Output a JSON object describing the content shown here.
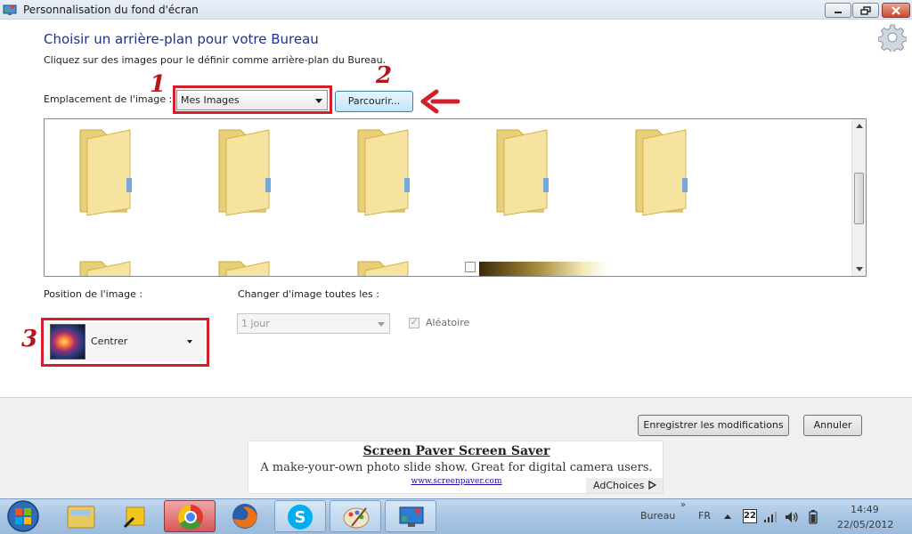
{
  "window": {
    "title": "Personnalisation du fond d'écran"
  },
  "page": {
    "heading": "Choisir un arrière-plan pour votre Bureau",
    "subheading": "Cliquez sur des images pour le définir comme arrière-plan du Bureau."
  },
  "location": {
    "label": "Emplacement de l'image :",
    "value": "Mes Images",
    "browse_label": "Parcourir..."
  },
  "annotations": {
    "step1": "1",
    "step2": "2",
    "step3": "3",
    "color": "#d31f2b"
  },
  "position": {
    "label": "Position de l'image :",
    "value": "Centrer"
  },
  "interval": {
    "label": "Changer d'image toutes les :",
    "value": "1 jour",
    "shuffle_label": "Aléatoire",
    "shuffle_checked": true
  },
  "buttons": {
    "save_label": "Enregistrer les modifications",
    "cancel_label": "Annuler"
  },
  "ad": {
    "title": "Screen Paver Screen Saver",
    "description": "A make-your-own photo slide show. Great for digital camera users.",
    "url": "www.screenpaver.com",
    "adchoices": "AdChoices"
  },
  "taskbar": {
    "items": [
      "windows-explorer-icon",
      "shortcut-icon",
      "chrome-icon",
      "firefox-icon",
      "skype-icon",
      "paint-icon",
      "personalization-icon"
    ],
    "toolbar_label": "Bureau",
    "language": "FR",
    "time": "14:49",
    "date": "22/05/2012",
    "calendar_day": "22"
  },
  "colors": {
    "heading": "#1e3287",
    "annotation_red": "#d31f2b",
    "taskbar": "#a8c5e3"
  }
}
